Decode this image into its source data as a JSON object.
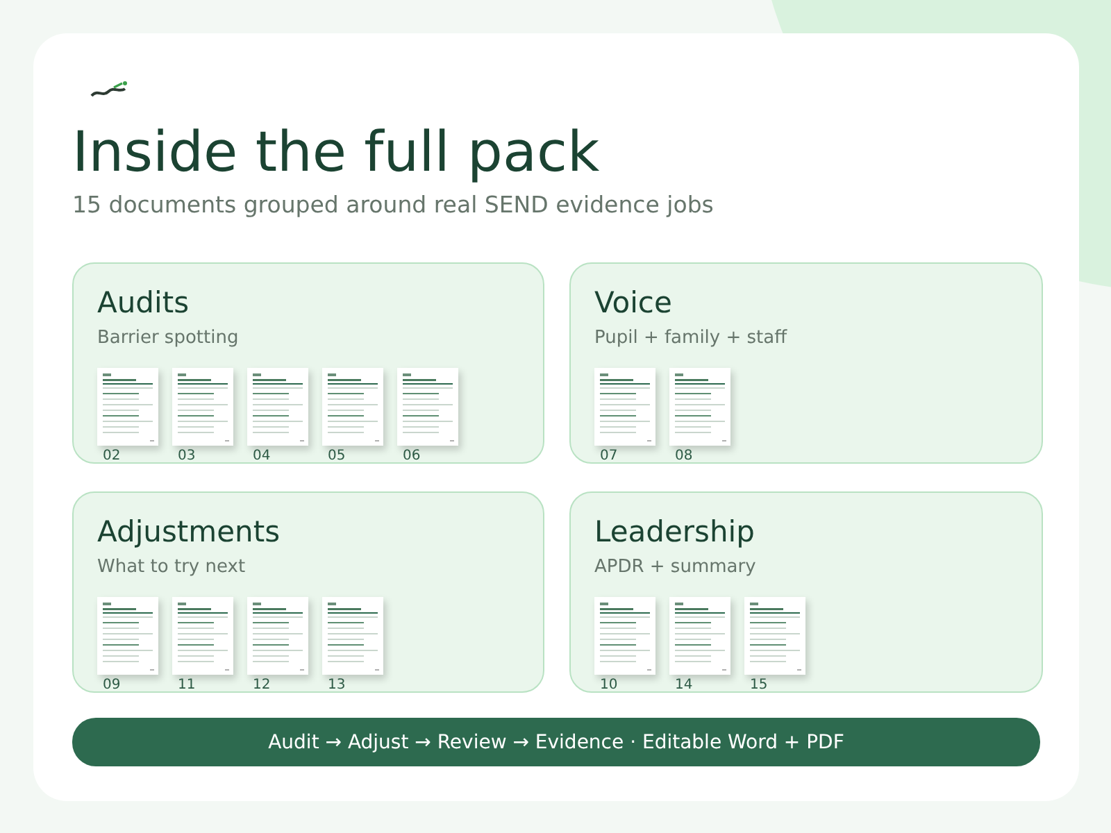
{
  "title": "Inside the full pack",
  "subtitle": "15 documents grouped around real SEND evidence jobs",
  "groups": [
    {
      "title": "Audits",
      "subtitle": "Barrier spotting",
      "documents": [
        {
          "number": "02"
        },
        {
          "number": "03"
        },
        {
          "number": "04"
        },
        {
          "number": "05"
        },
        {
          "number": "06"
        }
      ]
    },
    {
      "title": "Voice",
      "subtitle": "Pupil + family + staff",
      "documents": [
        {
          "number": "07"
        },
        {
          "number": "08"
        }
      ]
    },
    {
      "title": "Adjustments",
      "subtitle": "What to try next",
      "documents": [
        {
          "number": "09"
        },
        {
          "number": "11"
        },
        {
          "number": "12"
        },
        {
          "number": "13"
        }
      ]
    },
    {
      "title": "Leadership",
      "subtitle": "APDR + summary",
      "documents": [
        {
          "number": "10"
        },
        {
          "number": "14"
        },
        {
          "number": "15"
        }
      ]
    }
  ],
  "footer": "Audit → Adjust → Review → Evidence · Editable Word + PDF"
}
